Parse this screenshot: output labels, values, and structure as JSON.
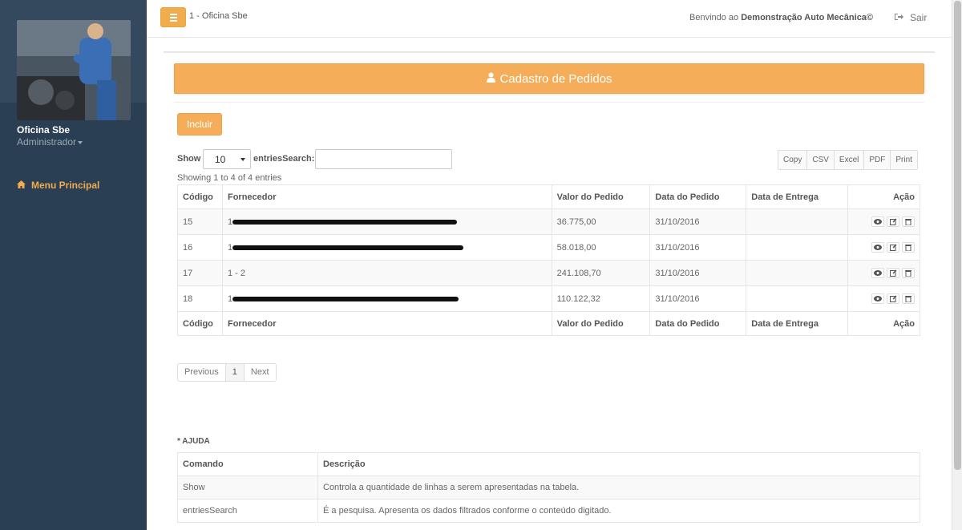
{
  "sidebar": {
    "profile_name": "Oficina Sbe",
    "profile_role": "Administrador",
    "menu_item": "Menu Principal"
  },
  "topbar": {
    "breadcrumb": "1 - Oficina Sbe",
    "welcome_prefix": "Benvindo ao",
    "welcome_company": "Demonstração Auto Mecânica©",
    "logout_label": "Sair"
  },
  "page": {
    "title": "Cadastro de Pedidos",
    "add_button": "Incluir"
  },
  "table_controls": {
    "show_label": "Show",
    "show_value": "10",
    "entries_search_label": "entriesSearch:",
    "search_value": "",
    "export_buttons": [
      "Copy",
      "CSV",
      "Excel",
      "PDF",
      "Print"
    ],
    "showing_text": "Showing 1 to 4 of 4 entries"
  },
  "orders": {
    "columns": [
      "Código",
      "Fornecedor",
      "Valor do Pedido",
      "Data do Pedido",
      "Data de Entrega",
      "Ação"
    ],
    "rows": [
      {
        "codigo": "15",
        "fornecedor": "1",
        "valor": "36.775,00",
        "data_pedido": "31/10/2016",
        "data_entrega": ""
      },
      {
        "codigo": "16",
        "fornecedor": "1",
        "valor": "58.018,00",
        "data_pedido": "31/10/2016",
        "data_entrega": ""
      },
      {
        "codigo": "17",
        "fornecedor": "1 - 2",
        "valor": "241.108,70",
        "data_pedido": "31/10/2016",
        "data_entrega": ""
      },
      {
        "codigo": "18",
        "fornecedor": "1",
        "valor": "110.122,32",
        "data_pedido": "31/10/2016",
        "data_entrega": ""
      }
    ]
  },
  "pagination": {
    "previous": "Previous",
    "current": "1",
    "next": "Next"
  },
  "help": {
    "title": "* AJUDA",
    "columns": [
      "Comando",
      "Descrição"
    ],
    "rows": [
      {
        "comando": "Show",
        "descricao": "Controla a quantidade de linhas a serem apresentadas na tabela."
      },
      {
        "comando": "entriesSearch",
        "descricao": "É a pesquisa. Apresenta os dados filtrados conforme o conteúdo digitado."
      }
    ]
  },
  "icons": {
    "toggle": "hamburger-icon",
    "logout": "sign-out-icon",
    "menu": "home-icon",
    "header": "user-icon",
    "row_actions": [
      "eye-icon",
      "edit-icon",
      "trash-icon"
    ]
  },
  "colors": {
    "accent": "#f5ad5a",
    "sidebar": "#2a3f54"
  }
}
